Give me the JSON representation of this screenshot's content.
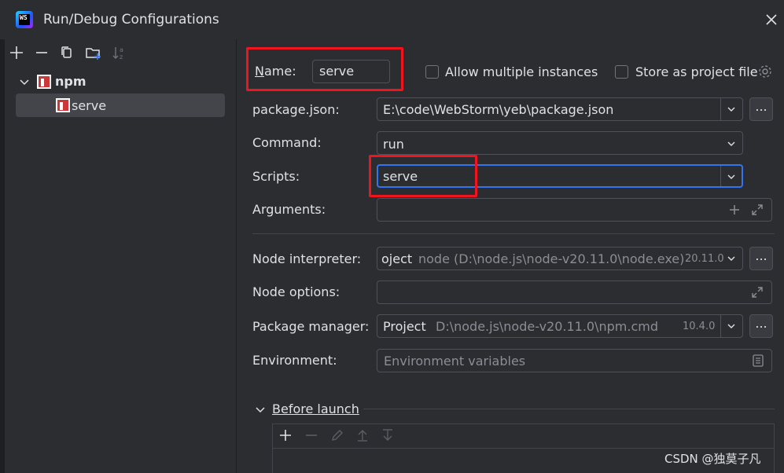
{
  "window": {
    "title": "Run/Debug Configurations",
    "app_icon_text": "WS"
  },
  "tree": {
    "group_label": "npm",
    "item_label": "serve"
  },
  "form": {
    "name_label": "Name:",
    "name_value": "serve",
    "allow_multiple_label": "Allow multiple instances",
    "store_project_label": "Store as project file",
    "package_json_label": "package.json:",
    "package_json_value": "E:\\code\\WebStorm\\yeb\\package.json",
    "command_label": "Command:",
    "command_value": "run",
    "scripts_label": "Scripts:",
    "scripts_value": "serve",
    "arguments_label": "Arguments:",
    "node_interpreter_label": "Node interpreter:",
    "node_interpreter_prefix": "oject",
    "node_interpreter_path": "node (D:\\node.js\\node-v20.11.0\\node.exe)",
    "node_interpreter_version": "20.11.0",
    "node_options_label": "Node options:",
    "package_manager_label": "Package manager:",
    "package_manager_prefix": "Project",
    "package_manager_path": "D:\\node.js\\node-v20.11.0\\npm.cmd",
    "package_manager_version": "10.4.0",
    "environment_label": "Environment:",
    "environment_placeholder": "Environment variables",
    "dots_label": "..."
  },
  "before_launch": {
    "label": "Before launch"
  },
  "watermark": "CSDN @独莫子凡",
  "colors": {
    "background": "#2b2d30",
    "highlight_red": "#f0141e",
    "focus_blue": "#3574f0",
    "npm_red": "#cb3837"
  }
}
